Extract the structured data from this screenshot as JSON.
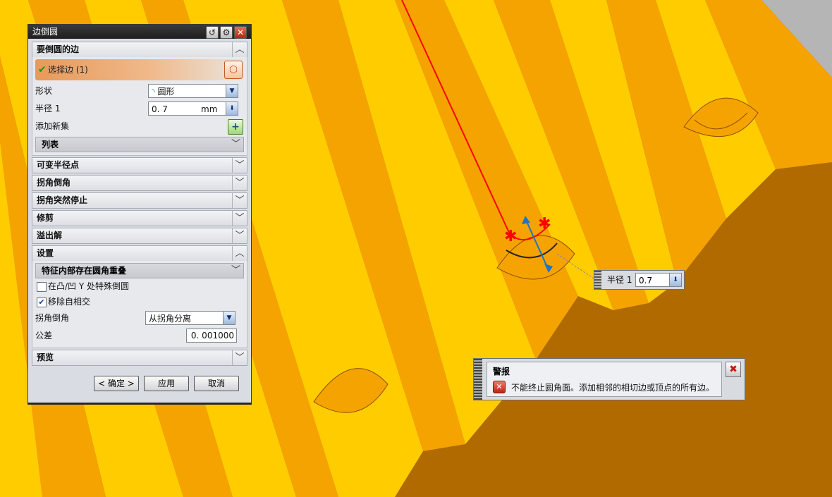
{
  "dialog": {
    "title": "边倒圆",
    "title_icons": [
      "reset-icon",
      "gear-icon",
      "close-icon"
    ],
    "sections": {
      "edges_to_blend": "要倒圆的边",
      "variable_radius": "可变半径点",
      "corner_setback": "拐角倒角",
      "stop_short_of_corner": "拐角突然停止",
      "trim": "修剪",
      "overflow": "溢出解",
      "settings": "设置",
      "preview": "预览"
    },
    "select_edge_label": "选择边 (1)",
    "shape_label": "形状",
    "shape_value": "圆形",
    "radius_label": "半径 1",
    "radius_value": "0. 7",
    "radius_unit": "mm",
    "add_new_set_label": "添加新集",
    "list_label": "列表",
    "settings_sub": "特征内部存在圆角重叠",
    "cb_special_y": "在凸/凹 Y 处特殊倒圆",
    "cb_remove_self_intersect": "移除自相交",
    "corner_setback_label": "拐角倒角",
    "corner_setback_value": "从拐角分离",
    "tolerance_label": "公差",
    "tolerance_value": "0. 001000",
    "ok": "< 确定 >",
    "apply": "应用",
    "cancel": "取消"
  },
  "radius_popup": {
    "label": "半径 1",
    "value": "0.7"
  },
  "alert": {
    "title": "警报",
    "message": "不能终止圆角面。添加相邻的相切边或顶点的所有边。"
  },
  "colors": {
    "face_light": "#ffcc00",
    "face_mid": "#f5a300",
    "face_dark": "#b06a00",
    "selected_edge": "#ff0000",
    "background_gray": "#b5b5b5"
  }
}
